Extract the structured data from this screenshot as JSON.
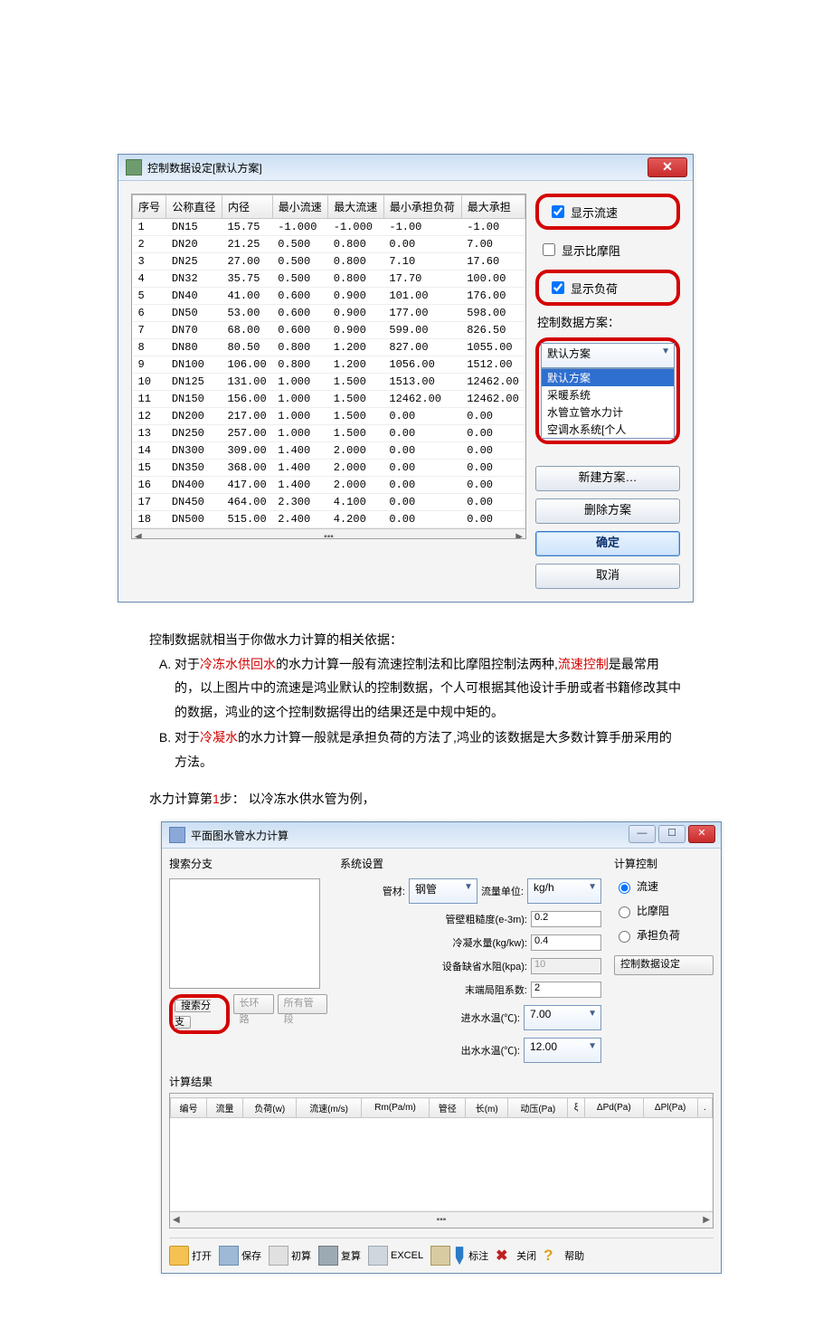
{
  "dialog1": {
    "title": "控制数据设定[默认方案]",
    "columns": [
      "序号",
      "公称直径",
      "内径",
      "最小流速",
      "最大流速",
      "最小承担负荷",
      "最大承担"
    ],
    "rows": [
      [
        "1",
        "DN15",
        "15.75",
        "-1.000",
        "-1.000",
        "-1.00",
        "-1.00"
      ],
      [
        "2",
        "DN20",
        "21.25",
        "0.500",
        "0.800",
        "0.00",
        "7.00"
      ],
      [
        "3",
        "DN25",
        "27.00",
        "0.500",
        "0.800",
        "7.10",
        "17.60"
      ],
      [
        "4",
        "DN32",
        "35.75",
        "0.500",
        "0.800",
        "17.70",
        "100.00"
      ],
      [
        "5",
        "DN40",
        "41.00",
        "0.600",
        "0.900",
        "101.00",
        "176.00"
      ],
      [
        "6",
        "DN50",
        "53.00",
        "0.600",
        "0.900",
        "177.00",
        "598.00"
      ],
      [
        "7",
        "DN70",
        "68.00",
        "0.600",
        "0.900",
        "599.00",
        "826.50"
      ],
      [
        "8",
        "DN80",
        "80.50",
        "0.800",
        "1.200",
        "827.00",
        "1055.00"
      ],
      [
        "9",
        "DN100",
        "106.00",
        "0.800",
        "1.200",
        "1056.00",
        "1512.00"
      ],
      [
        "10",
        "DN125",
        "131.00",
        "1.000",
        "1.500",
        "1513.00",
        "12462.00"
      ],
      [
        "11",
        "DN150",
        "156.00",
        "1.000",
        "1.500",
        "12462.00",
        "12462.00"
      ],
      [
        "12",
        "DN200",
        "217.00",
        "1.000",
        "1.500",
        "0.00",
        "0.00"
      ],
      [
        "13",
        "DN250",
        "257.00",
        "1.000",
        "1.500",
        "0.00",
        "0.00"
      ],
      [
        "14",
        "DN300",
        "309.00",
        "1.400",
        "2.000",
        "0.00",
        "0.00"
      ],
      [
        "15",
        "DN350",
        "368.00",
        "1.400",
        "2.000",
        "0.00",
        "0.00"
      ],
      [
        "16",
        "DN400",
        "417.00",
        "1.400",
        "2.000",
        "0.00",
        "0.00"
      ],
      [
        "17",
        "DN450",
        "464.00",
        "2.300",
        "4.100",
        "0.00",
        "0.00"
      ],
      [
        "18",
        "DN500",
        "515.00",
        "2.400",
        "4.200",
        "0.00",
        "0.00"
      ]
    ],
    "chk_flow": "显示流速",
    "chk_fric": "显示比摩阻",
    "chk_load": "显示负荷",
    "scheme_label": "控制数据方案：",
    "scheme_selected": "默认方案",
    "scheme_options": [
      "默认方案",
      "采暖系统",
      "水管立管水力计",
      "空调水系统[个人"
    ],
    "btn_new": "新建方案…",
    "btn_del": "删除方案",
    "btn_ok": "确定",
    "btn_cancel": "取消"
  },
  "paragraph": {
    "intro": "控制数据就相当于你做水力计算的相关依据：",
    "A_pre": "对于",
    "A_hl1": "冷冻水供回水",
    "A_mid": "的水力计算一般有流速控制法和比摩阻控制法两种,",
    "A_hl2": "流速控制",
    "A_post": "是最常用的，以上图片中的流速是鸿业默认的控制数据，个人可根据其他设计手册或者书籍修改其中的数据，鸿业的这个控制数据得出的结果还是中规中矩的。",
    "B_pre": "对于",
    "B_hl": "冷凝水",
    "B_post": "的水力计算一般就是承担负荷的方法了,鸿业的该数据是大多数计算手册采用的方法。",
    "step_pre": "水力计算第",
    "step_num": "1",
    "step_post": "步：  以冷冻水供水管为例，"
  },
  "dialog2": {
    "title": "平面图水管水力计算",
    "search_label": "搜索分支",
    "btn_search": "搜索分支",
    "btn_longest": "长环路",
    "btn_all": "所有管段",
    "sys_label": "系统设置",
    "pipe_mat_lbl": "管材:",
    "pipe_mat_val": "钢管",
    "flow_unit_lbl": "流量单位:",
    "flow_unit_val": "kg/h",
    "rough_lbl": "管壁粗糙度(e-3m):",
    "rough_val": "0.2",
    "cond_lbl": "冷凝水量(kg/kw):",
    "cond_val": "0.4",
    "equip_lbl": "设备缺省水阻(kpa):",
    "equip_val": "10",
    "end_lbl": "末端局阻系数:",
    "end_val": "2",
    "tin_lbl": "进水水温(℃):",
    "tin_val": "7.00",
    "tout_lbl": "出水水温(℃):",
    "tout_val": "12.00",
    "calc_ctrl": "计算控制",
    "r_flow": "流速",
    "r_fric": "比摩阻",
    "r_load": "承担负荷",
    "btn_ctrl": "控制数据设定",
    "res_label": "计算结果",
    "res_cols": [
      "编号",
      "流量",
      "负荷(w)",
      "流速(m/s)",
      "Rm(Pa/m)",
      "管径",
      "长(m)",
      "动压(Pa)",
      "ξ",
      "ΔPd(Pa)",
      "ΔPl(Pa)",
      "."
    ],
    "tb_open": "打开",
    "tb_save": "保存",
    "tb_calc": "初算",
    "tb_copy": "复算",
    "tb_xls": "EXCEL",
    "tb_note": "标注",
    "tb_close": "关闭",
    "tb_help": "帮助"
  }
}
